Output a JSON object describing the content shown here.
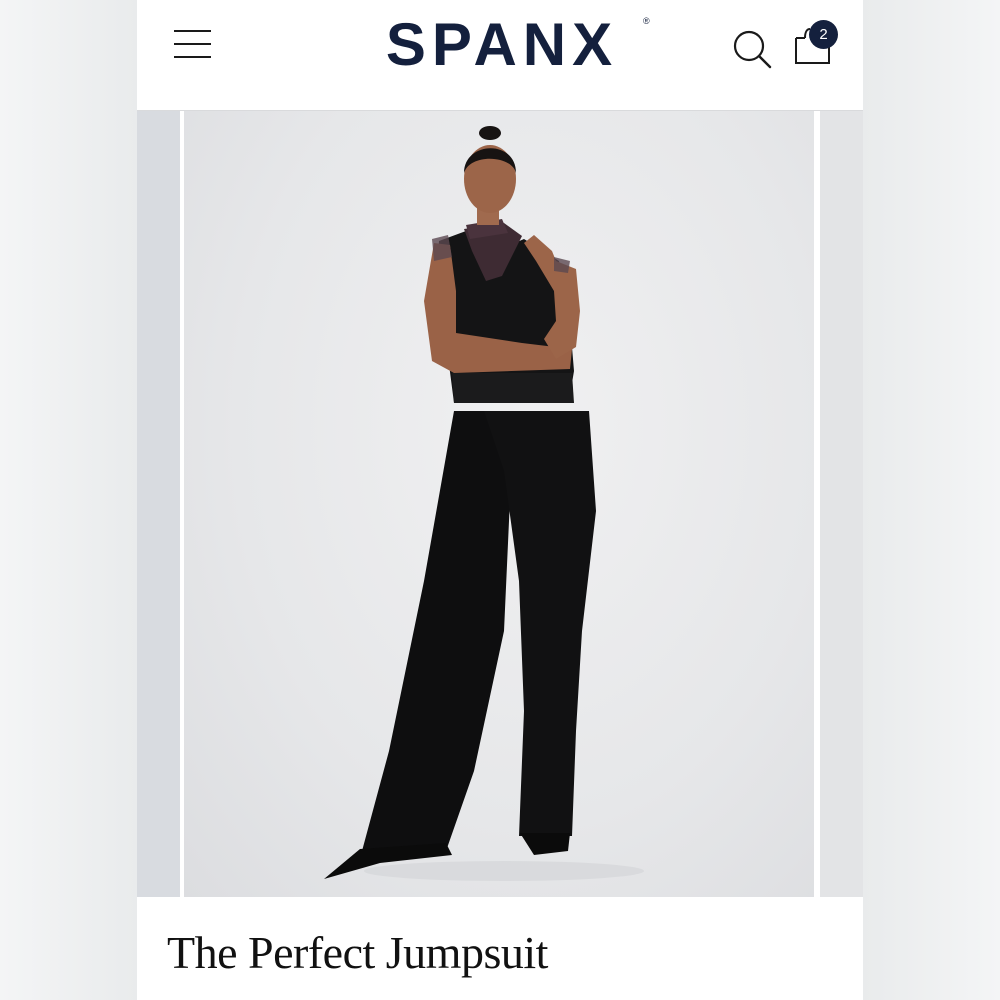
{
  "header": {
    "brand": "SPANX",
    "registered_mark": "®",
    "menu_icon": "hamburger-menu-icon",
    "search_icon": "search-icon",
    "cart_icon": "shopping-bag-icon",
    "cart_count": "2"
  },
  "product": {
    "title": "The Perfect Jumpsuit"
  },
  "colors": {
    "brand_navy": "#14203d",
    "background": "#ffffff"
  }
}
